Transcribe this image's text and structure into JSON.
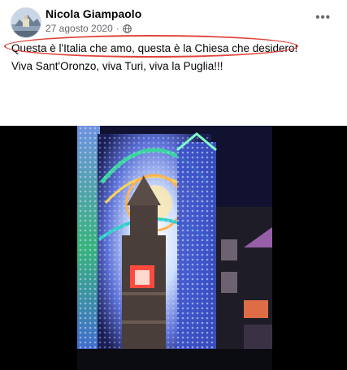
{
  "post": {
    "author_name": "Nicola Giampaolo",
    "date": "27 agosto 2020",
    "date_separator": "·",
    "privacy_icon": "globe-icon",
    "more_icon": "more-options-icon",
    "more_glyph": "•••",
    "text_line_1": "Questa è l'Italia che amo, questa è la Chiesa che desidero!",
    "text_line_2": "Viva Sant'Oronzo, viva Turi, viva la Puglia!!!",
    "highlight_color": "#e0433b",
    "video_thumbnail": "festival-lights-church-tower-video"
  }
}
